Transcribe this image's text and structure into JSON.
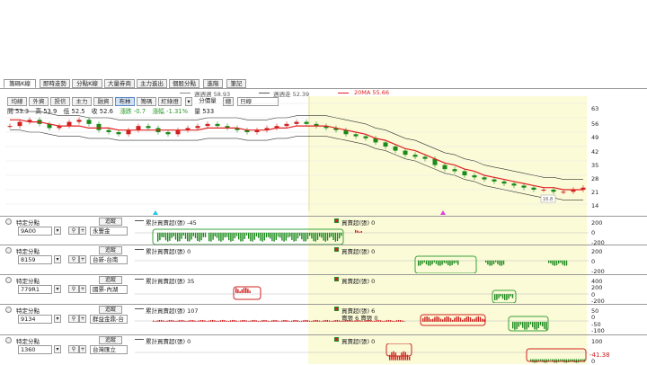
{
  "tabs": [
    "籌碼K線",
    "即時走勢",
    "分點K線",
    "大量券商",
    "主力進出",
    "個股分點",
    "進階",
    "筆記"
  ],
  "legend": [
    {
      "label": "週週週 58.93",
      "color": "#888888"
    },
    {
      "label": "週週走 52.39",
      "color": "#555555"
    },
    {
      "label": "20MA 55.66",
      "color": "#e02020"
    }
  ],
  "toolbar": {
    "buttons": [
      "均線",
      "外資",
      "投信",
      "主力",
      "融資",
      "布林",
      "籌碼",
      "紅綠燈"
    ],
    "active": "布林",
    "dropdown_label": "分價量",
    "dropdown_btn": "總",
    "period": "日線"
  },
  "stats": {
    "open": "開 53.3",
    "high": "高 53.9",
    "low": "低 52.5",
    "close": "收 52.6",
    "change": "漲跌 -0.7",
    "pct": "漲幅 -1.31%",
    "volume": "量 533"
  },
  "price_chart": {
    "yticks": [
      "63",
      "56",
      "49",
      "42",
      "35",
      "28",
      "21",
      "14"
    ],
    "ymin": 14,
    "ymax": 63,
    "box_label": "16.8"
  },
  "panels": [
    {
      "type_label": "特定分點",
      "btn": "追蹤",
      "code": "9A00",
      "name": "永豐金",
      "cum_title": "累計買賣超(張) -45",
      "day_title": "買賣超(張) 0",
      "extra": "",
      "yticks": [
        "200",
        "0",
        "-200"
      ]
    },
    {
      "type_label": "特定分點",
      "btn": "追蹤",
      "code": "8159",
      "name": "台新-台南",
      "cum_title": "累計買賣超(張) 0",
      "day_title": "買賣超(張) 0",
      "extra": "",
      "yticks": [
        "200",
        "0",
        "-200"
      ]
    },
    {
      "type_label": "特定分點",
      "btn": "追蹤",
      "code": "779R1",
      "name": "國票-內湖",
      "cum_title": "累計買賣超(張) 35",
      "day_title": "買賣超(張) 0",
      "extra": "",
      "yticks": [
        "400",
        "200",
        "0",
        "-200"
      ]
    },
    {
      "type_label": "特定分點",
      "btn": "追蹤",
      "code": "9134",
      "name": "群益金鼎-台",
      "cum_title": "累計買賣超(張) 107",
      "day_title": "買賣超(張) 6",
      "extra": "賣張 6 賣張 0",
      "yticks": [
        "50",
        "0",
        "-50",
        "-100"
      ]
    },
    {
      "type_label": "特定分點",
      "btn": "追蹤",
      "code": "1360",
      "name": "台灣匯立",
      "cum_title": "累計買賣超(張) 0",
      "day_title": "買賣超(張) 0",
      "extra": "",
      "yticks": [
        "100",
        "0"
      ]
    }
  ],
  "last_value": "-41.38",
  "chart_data": {
    "type": "line",
    "series": [
      {
        "values": [
          52,
          54,
          55,
          53,
          51,
          52,
          54,
          55,
          53,
          50,
          49,
          48,
          50,
          52,
          51,
          49,
          48,
          50,
          51,
          52,
          53,
          52,
          51,
          50,
          49,
          50,
          51,
          52,
          53,
          54,
          53,
          52,
          51,
          50,
          48,
          47,
          46,
          44,
          42,
          40,
          38,
          37,
          36,
          33,
          31,
          30,
          28,
          27,
          26,
          25,
          24,
          23,
          22,
          21,
          21,
          20,
          20,
          21,
          22
        ]
      },
      {
        "values": [
          55,
          55,
          54,
          54,
          53,
          52,
          52,
          52,
          51,
          51,
          51,
          50,
          50,
          50,
          50,
          50,
          50,
          50,
          50,
          50,
          51,
          51,
          51,
          51,
          50,
          50,
          50,
          51,
          51,
          52,
          52,
          52,
          52,
          51,
          50,
          49,
          48,
          46,
          45,
          43,
          41,
          40,
          38,
          36,
          34,
          33,
          31,
          30,
          28,
          27,
          26,
          25,
          24,
          23,
          22,
          22,
          21,
          21,
          21
        ]
      }
    ]
  }
}
